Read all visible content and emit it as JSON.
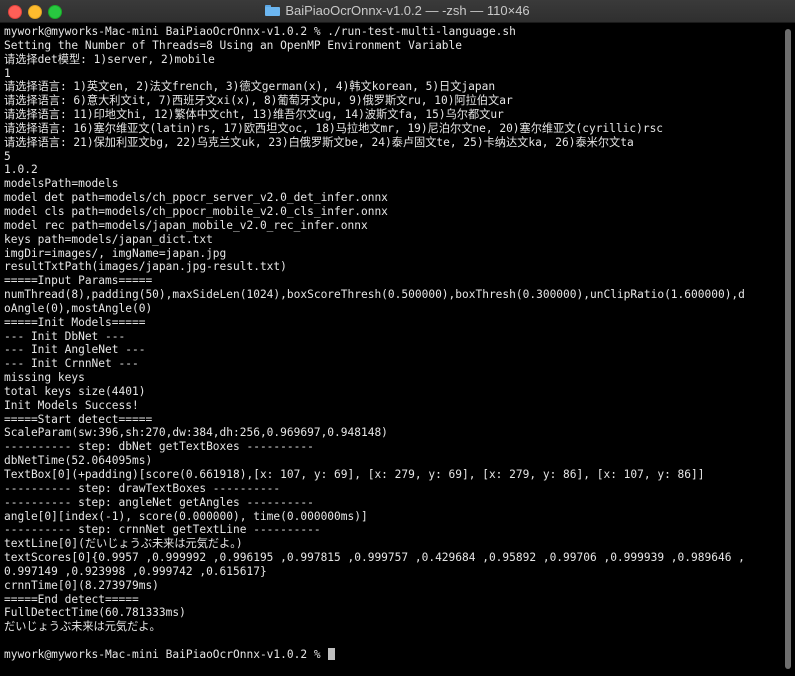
{
  "window": {
    "title": "BaiPiaoOcrOnnx-v1.0.2 — -zsh — 110×46"
  },
  "terminal": {
    "lines": [
      "mywork@myworks-Mac-mini BaiPiaoOcrOnnx-v1.0.2 % ./run-test-multi-language.sh",
      "Setting the Number of Threads=8 Using an OpenMP Environment Variable",
      "请选择det模型: 1)server, 2)mobile",
      "1",
      "请选择语言: 1)英文en, 2)法文french, 3)德文german(x), 4)韩文korean, 5)日文japan",
      "请选择语言: 6)意大利文it, 7)西班牙文xi(x), 8)葡萄牙文pu, 9)俄罗斯文ru, 10)阿拉伯文ar",
      "请选择语言: 11)印地文hi, 12)繁体中文cht, 13)维吾尔文ug, 14)波斯文fa, 15)乌尔都文ur",
      "请选择语言: 16)塞尔维亚文(latin)rs, 17)欧西坦文oc, 18)马拉地文mr, 19)尼泊尔文ne, 20)塞尔维亚文(cyrillic)rsc",
      "请选择语言: 21)保加利亚文bg, 22)乌克兰文uk, 23)白俄罗斯文be, 24)泰卢固文te, 25)卡纳达文ka, 26)泰米尔文ta",
      "5",
      "1.0.2",
      "modelsPath=models",
      "model det path=models/ch_ppocr_server_v2.0_det_infer.onnx",
      "model cls path=models/ch_ppocr_mobile_v2.0_cls_infer.onnx",
      "model rec path=models/japan_mobile_v2.0_rec_infer.onnx",
      "keys path=models/japan_dict.txt",
      "imgDir=images/, imgName=japan.jpg",
      "resultTxtPath(images/japan.jpg-result.txt)",
      "=====Input Params=====",
      "numThread(8),padding(50),maxSideLen(1024),boxScoreThresh(0.500000),boxThresh(0.300000),unClipRatio(1.600000),d",
      "oAngle(0),mostAngle(0)",
      "=====Init Models=====",
      "--- Init DbNet ---",
      "--- Init AngleNet ---",
      "--- Init CrnnNet ---",
      "missing keys",
      "total keys size(4401)",
      "Init Models Success!",
      "=====Start detect=====",
      "ScaleParam(sw:396,sh:270,dw:384,dh:256,0.969697,0.948148)",
      "---------- step: dbNet getTextBoxes ----------",
      "dbNetTime(52.064095ms)",
      "TextBox[0](+padding)[score(0.661918),[x: 107, y: 69], [x: 279, y: 69], [x: 279, y: 86], [x: 107, y: 86]]",
      "---------- step: drawTextBoxes ----------",
      "---------- step: angleNet getAngles ----------",
      "angle[0][index(-1), score(0.000000), time(0.000000ms)]",
      "---------- step: crnnNet getTextLine ----------",
      "textLine[0](だいじょうぶ未来は元気だよ。)",
      "textScores[0]{0.9957 ,0.999992 ,0.996195 ,0.997815 ,0.999757 ,0.429684 ,0.95892 ,0.99706 ,0.999939 ,0.989646 ,",
      "0.997149 ,0.923998 ,0.999742 ,0.615617}",
      "crnnTime[0](8.273979ms)",
      "=====End detect=====",
      "FullDetectTime(60.781333ms)",
      "だいじょうぶ未来は元気だよ。",
      "",
      "mywork@myworks-Mac-mini BaiPiaoOcrOnnx-v1.0.2 % "
    ]
  },
  "colors": {
    "background": "#000000",
    "text": "#e6e6e6",
    "titlebar": "#333333",
    "close": "#ff5f57",
    "minimize": "#febc2e",
    "maximize": "#28c840"
  },
  "icons": {
    "title_icon": "folder-icon",
    "cursor": "block-cursor"
  }
}
